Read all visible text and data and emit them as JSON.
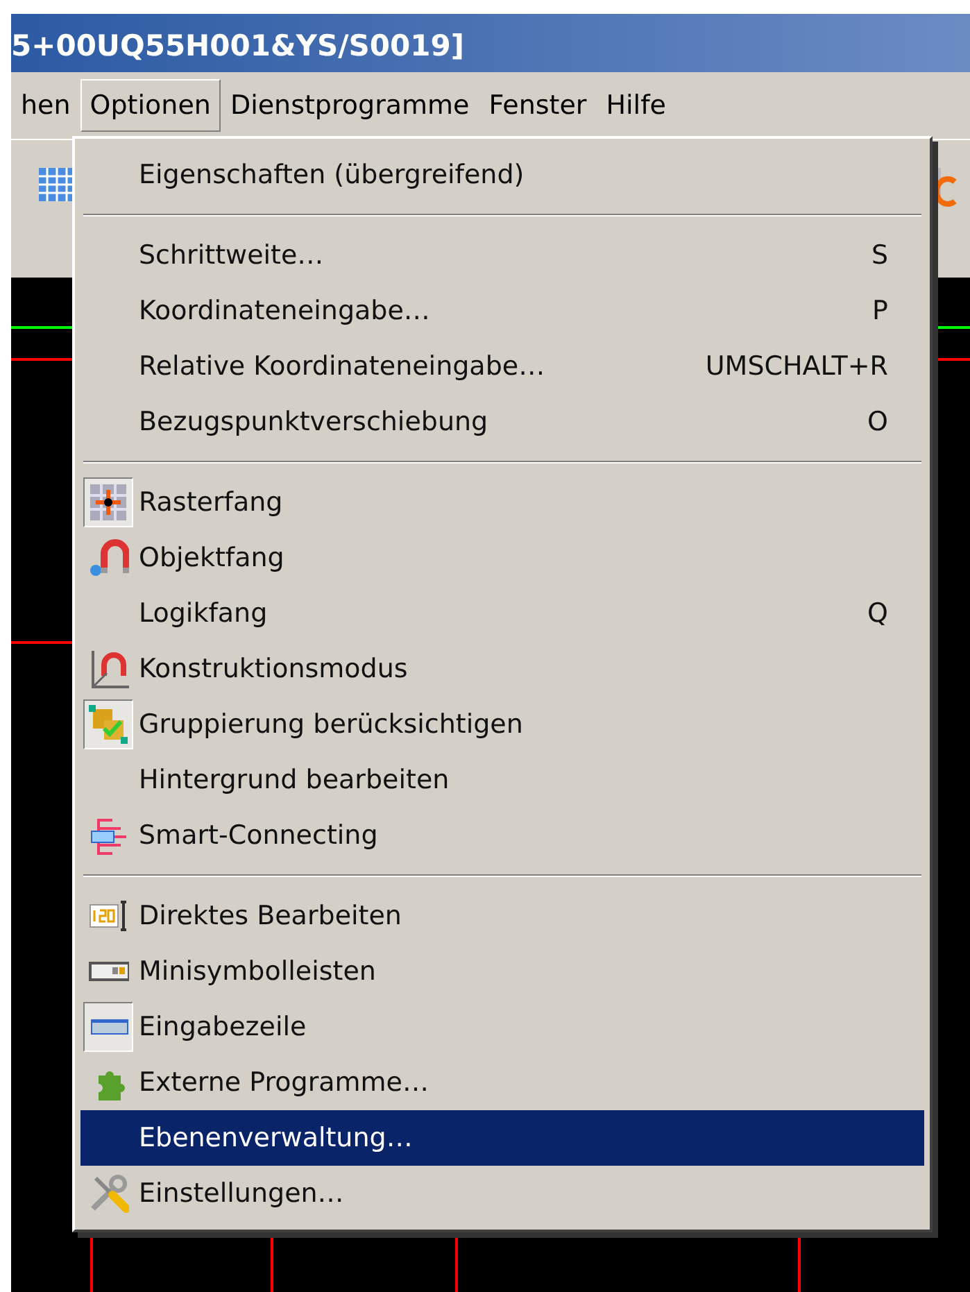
{
  "window": {
    "title": "5+00UQ55H001&YS/S0019]"
  },
  "menu_bar": [
    {
      "label": "hen",
      "open": false
    },
    {
      "label": "Optionen",
      "open": true
    },
    {
      "label": "Dienstprogramme",
      "open": false
    },
    {
      "label": "Fenster",
      "open": false
    },
    {
      "label": "Hilfe",
      "open": false
    }
  ],
  "menu": {
    "items": [
      {
        "kind": "item",
        "label": "Eigenschaften (übergreifend)",
        "selected": false,
        "checked": false
      },
      {
        "kind": "separator"
      },
      {
        "kind": "item",
        "label": "Schrittweite…",
        "shortcut": "S",
        "selected": false,
        "checked": false
      },
      {
        "kind": "item",
        "label": "Koordinateneingabe…",
        "shortcut": "P",
        "selected": false,
        "checked": false
      },
      {
        "kind": "item",
        "label": "Relative Koordinateneingabe…",
        "shortcut": "UMSCHALT+R",
        "selected": false,
        "checked": false
      },
      {
        "kind": "item",
        "label": "Bezugspunktverschiebung",
        "shortcut": "O",
        "selected": false,
        "checked": false
      },
      {
        "kind": "separator"
      },
      {
        "kind": "item",
        "label": "Rasterfang",
        "selected": false,
        "checked": true
      },
      {
        "kind": "item",
        "label": "Objektfang",
        "selected": false,
        "checked": false
      },
      {
        "kind": "item",
        "label": "Logikfang",
        "shortcut": "Q",
        "selected": false,
        "checked": false
      },
      {
        "kind": "item",
        "label": "Konstruktionsmodus",
        "selected": false,
        "checked": false
      },
      {
        "kind": "item",
        "label": "Gruppierung berücksichtigen",
        "selected": false,
        "checked": true
      },
      {
        "kind": "item",
        "label": "Hintergrund bearbeiten",
        "selected": false,
        "checked": false
      },
      {
        "kind": "item",
        "label": "Smart-Connecting",
        "selected": false,
        "checked": false
      },
      {
        "kind": "separator"
      },
      {
        "kind": "item",
        "label": "Direktes Bearbeiten",
        "selected": false,
        "checked": false
      },
      {
        "kind": "item",
        "label": "Minisymbolleisten",
        "selected": false,
        "checked": false
      },
      {
        "kind": "item",
        "label": "Eingabezeile",
        "selected": false,
        "checked": true
      },
      {
        "kind": "item",
        "label": "Externe Programme…",
        "selected": false,
        "checked": false
      },
      {
        "kind": "item",
        "label": "Ebenenverwaltung…",
        "selected": true,
        "checked": false
      },
      {
        "kind": "item",
        "label": "Einstellungen…",
        "selected": false,
        "checked": false
      }
    ]
  }
}
